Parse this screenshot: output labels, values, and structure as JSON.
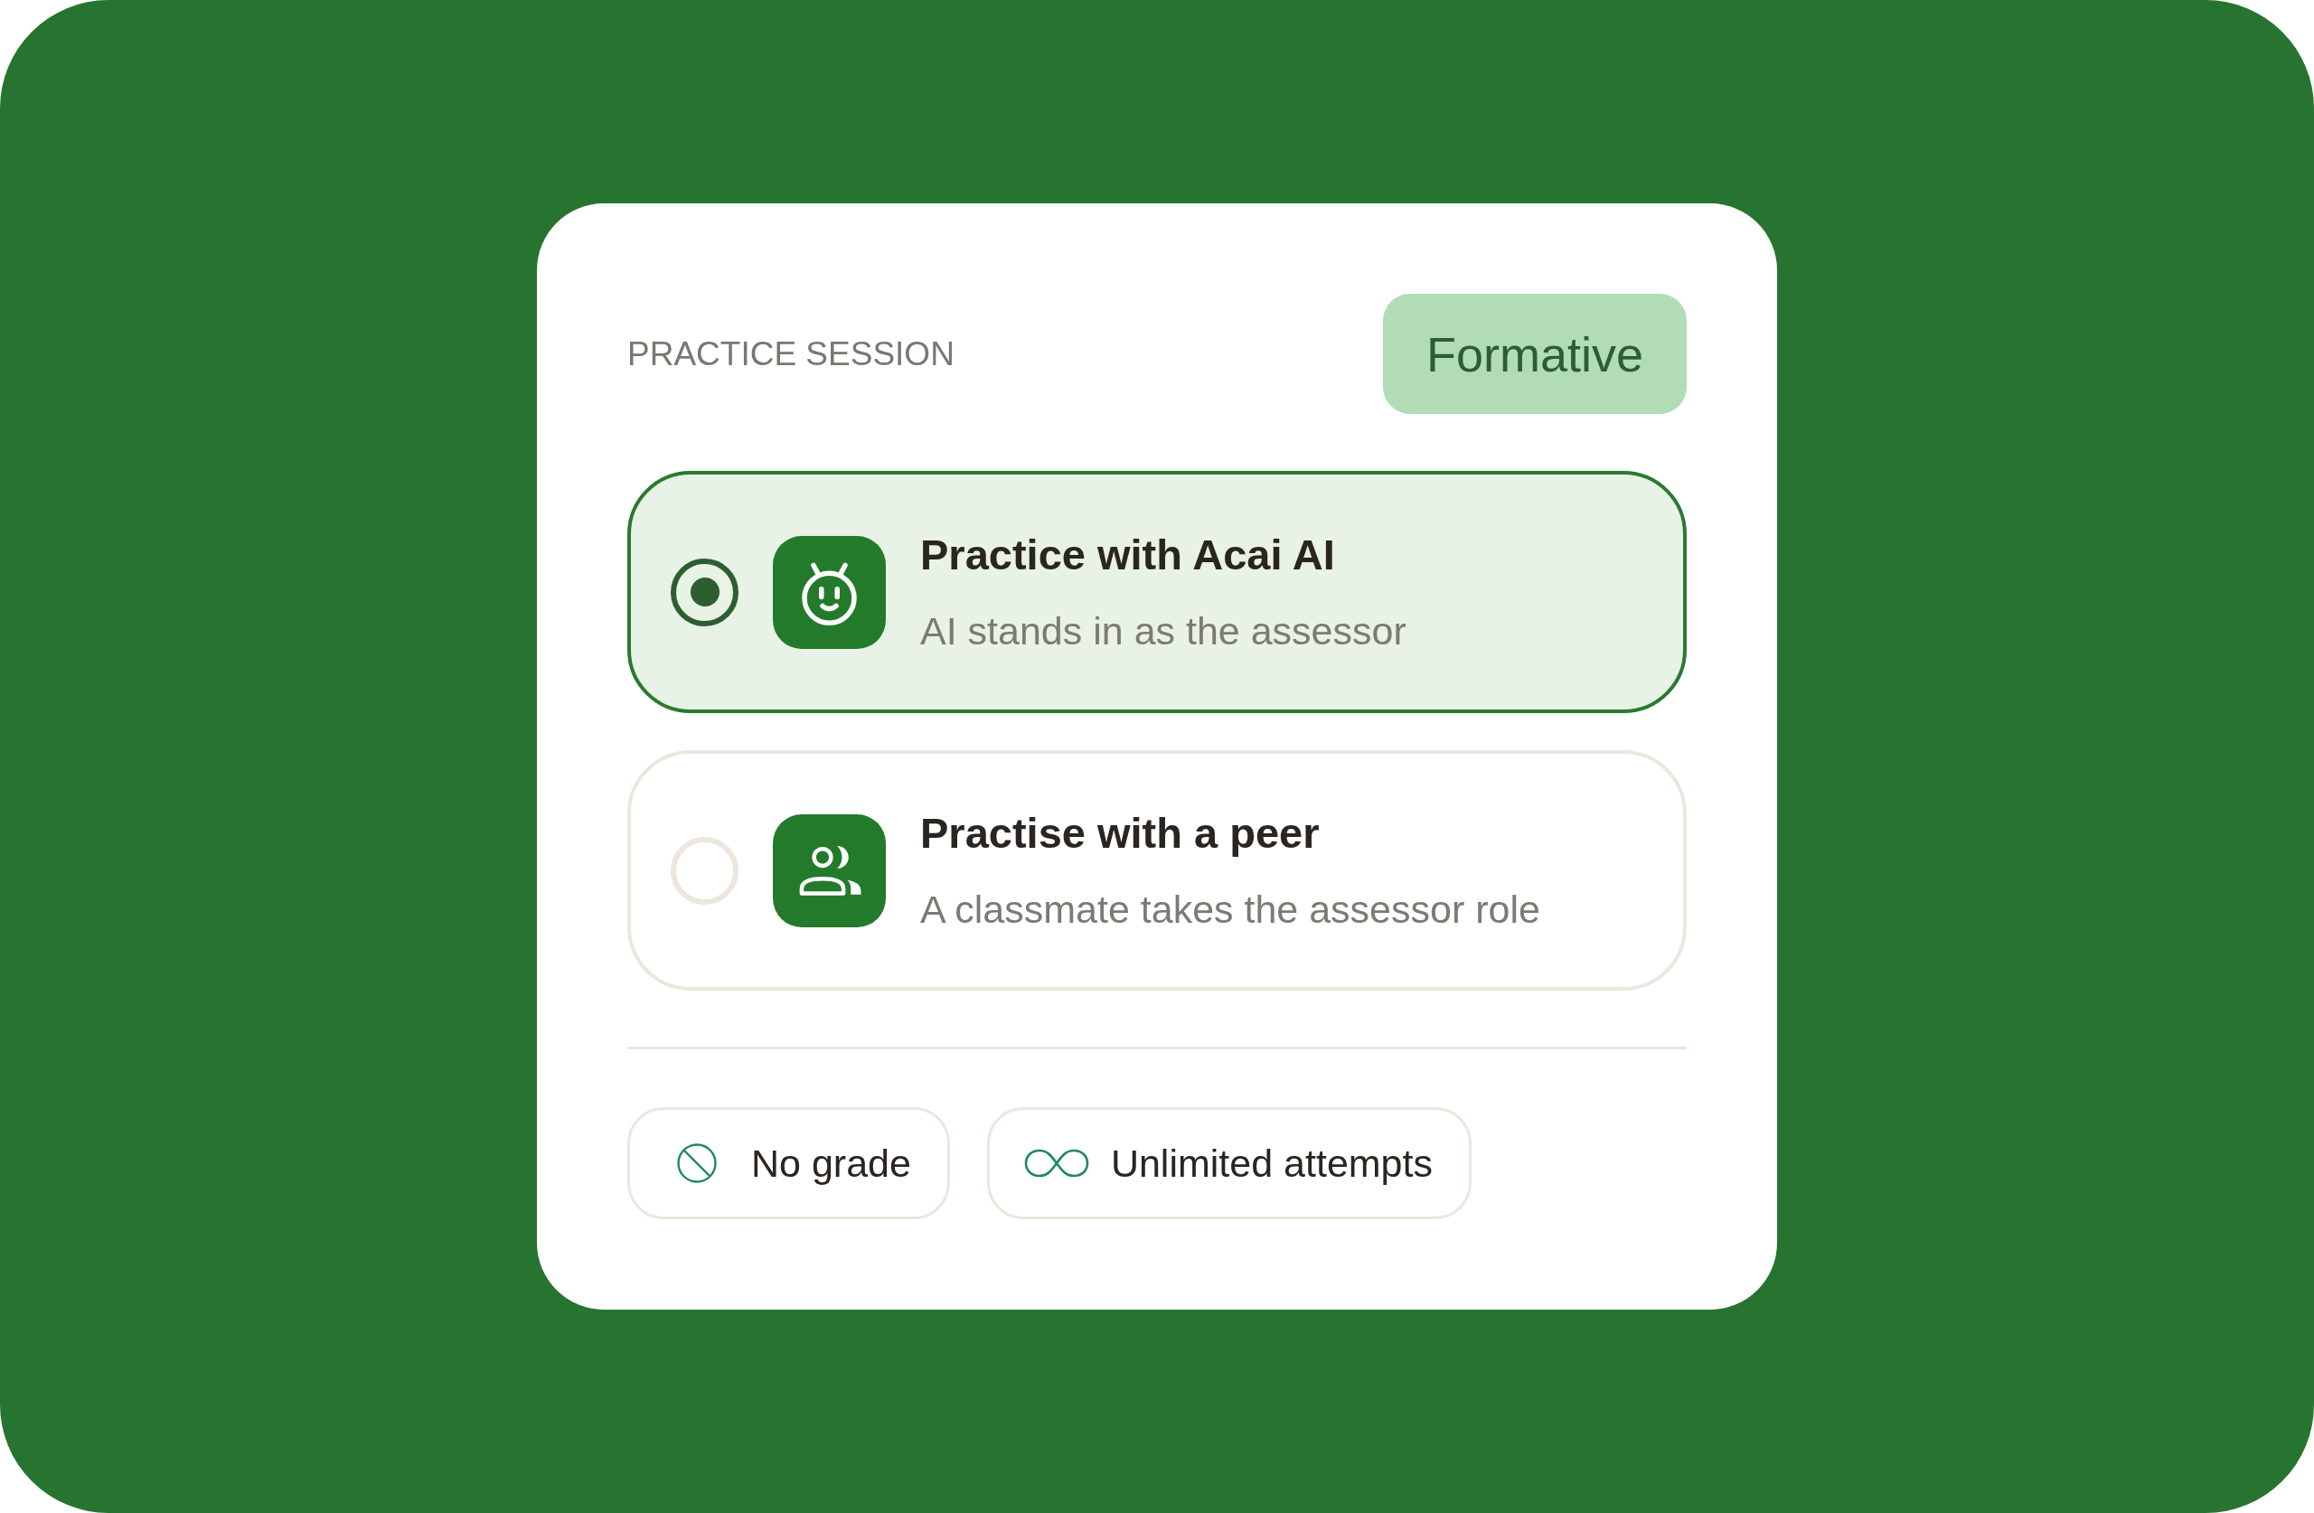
{
  "header": {
    "label": "PRACTICE SESSION",
    "badge": "Formative"
  },
  "options": [
    {
      "kind": "robot",
      "title": "Practice with Acai AI",
      "subtitle": "AI stands in as the assessor",
      "selected": true
    },
    {
      "kind": "people",
      "title": "Practise with a peer",
      "subtitle": "A classmate takes the assessor role",
      "selected": false
    }
  ],
  "chips": [
    {
      "kind": "no-entry",
      "label": "No grade"
    },
    {
      "kind": "infinity",
      "label": "Unlimited attempts"
    }
  ]
}
